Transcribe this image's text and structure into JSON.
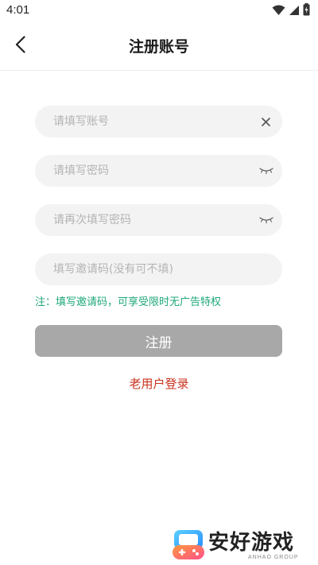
{
  "status_bar": {
    "time": "4:01",
    "icons": [
      "wifi-icon",
      "signal-icon",
      "battery-charging-icon"
    ]
  },
  "header": {
    "back_icon": "back-arrow-icon",
    "title": "注册账号"
  },
  "form": {
    "account": {
      "placeholder": "请填写账号",
      "value": "",
      "action_icon": "clear-icon"
    },
    "password": {
      "placeholder": "请填写密码",
      "value": "",
      "action_icon": "eye-closed-icon"
    },
    "confirm_password": {
      "placeholder": "请再次填写密码",
      "value": "",
      "action_icon": "eye-closed-icon"
    },
    "invite_code": {
      "placeholder": "填写邀请码(没有可不填)",
      "value": ""
    },
    "hint": "注：填写邀请码，可享受限时无广告特权",
    "hint_color": "#1fa87a",
    "submit_label": "注册",
    "submit_color": "#a8a8a8",
    "old_user_link": "老用户登录",
    "link_color": "#c9321f"
  },
  "watermark": {
    "title": "安好游戏",
    "subtitle": "ANHAO GROUP"
  }
}
